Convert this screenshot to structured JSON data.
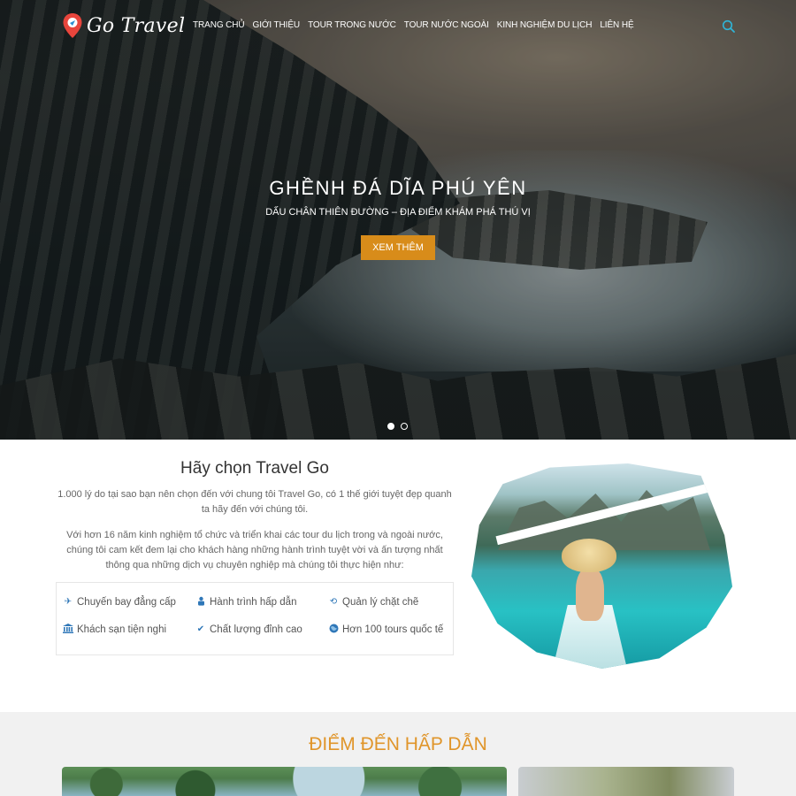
{
  "brand": {
    "name": "Go Travel"
  },
  "nav": {
    "items": [
      {
        "label": "TRANG CHỦ",
        "active": true
      },
      {
        "label": "GIỚI THIỆU"
      },
      {
        "label": "TOUR TRONG NƯỚC"
      },
      {
        "label": "TOUR NƯỚC NGOÀI"
      },
      {
        "label": "KINH NGHIỆM DU LỊCH"
      },
      {
        "label": "LIÊN HỆ"
      }
    ],
    "search_icon": "search-icon"
  },
  "hero": {
    "title": "GHỀNH ĐÁ DĨA PHÚ YÊN",
    "subtitle": "DẤU CHÂN THIÊN ĐƯỜNG – ĐỊA ĐIỂM KHÁM PHÁ THÚ VỊ",
    "button": "XEM THÊM",
    "slide_count": 2,
    "active_slide": 1
  },
  "about": {
    "title": "Hãy chọn Travel Go",
    "paragraph1": "1.000 lý do tại sao bạn nên chọn đến với chung tôi Travel Go, có 1 thế giới tuyệt đẹp quanh ta hãy đến với chúng tôi.",
    "paragraph2": "Với hơn 16 năm kinh nghiệm tổ chức và triển khai các tour du lịch trong và ngoài nước, chúng tôi cam kết đem lại cho khách hàng những hành trình tuyệt vời và ấn tượng nhất thông qua những dịch vụ chuyên nghiệp mà chúng tôi thực hiện như:",
    "features": [
      {
        "label": "Chuyến bay đẳng cấp",
        "icon": "plane-icon"
      },
      {
        "label": "Hành trình hấp dẫn",
        "icon": "traveler-icon"
      },
      {
        "label": "Quản lý chặt chẽ",
        "icon": "history-icon"
      },
      {
        "label": "Khách sạn tiện nghi",
        "icon": "bank-icon"
      },
      {
        "label": "Chất lượng đỉnh cao",
        "icon": "check-icon"
      },
      {
        "label": "Hơn 100 tours quốc tế",
        "icon": "globe-icon"
      }
    ]
  },
  "destinations": {
    "title": "ĐIỂM ĐẾN HẤP DẪN"
  },
  "colors": {
    "accent": "#d88c1a",
    "section_title": "#e0952a",
    "icon_blue": "#2f77b8",
    "search_icon": "#2fb5d8"
  }
}
